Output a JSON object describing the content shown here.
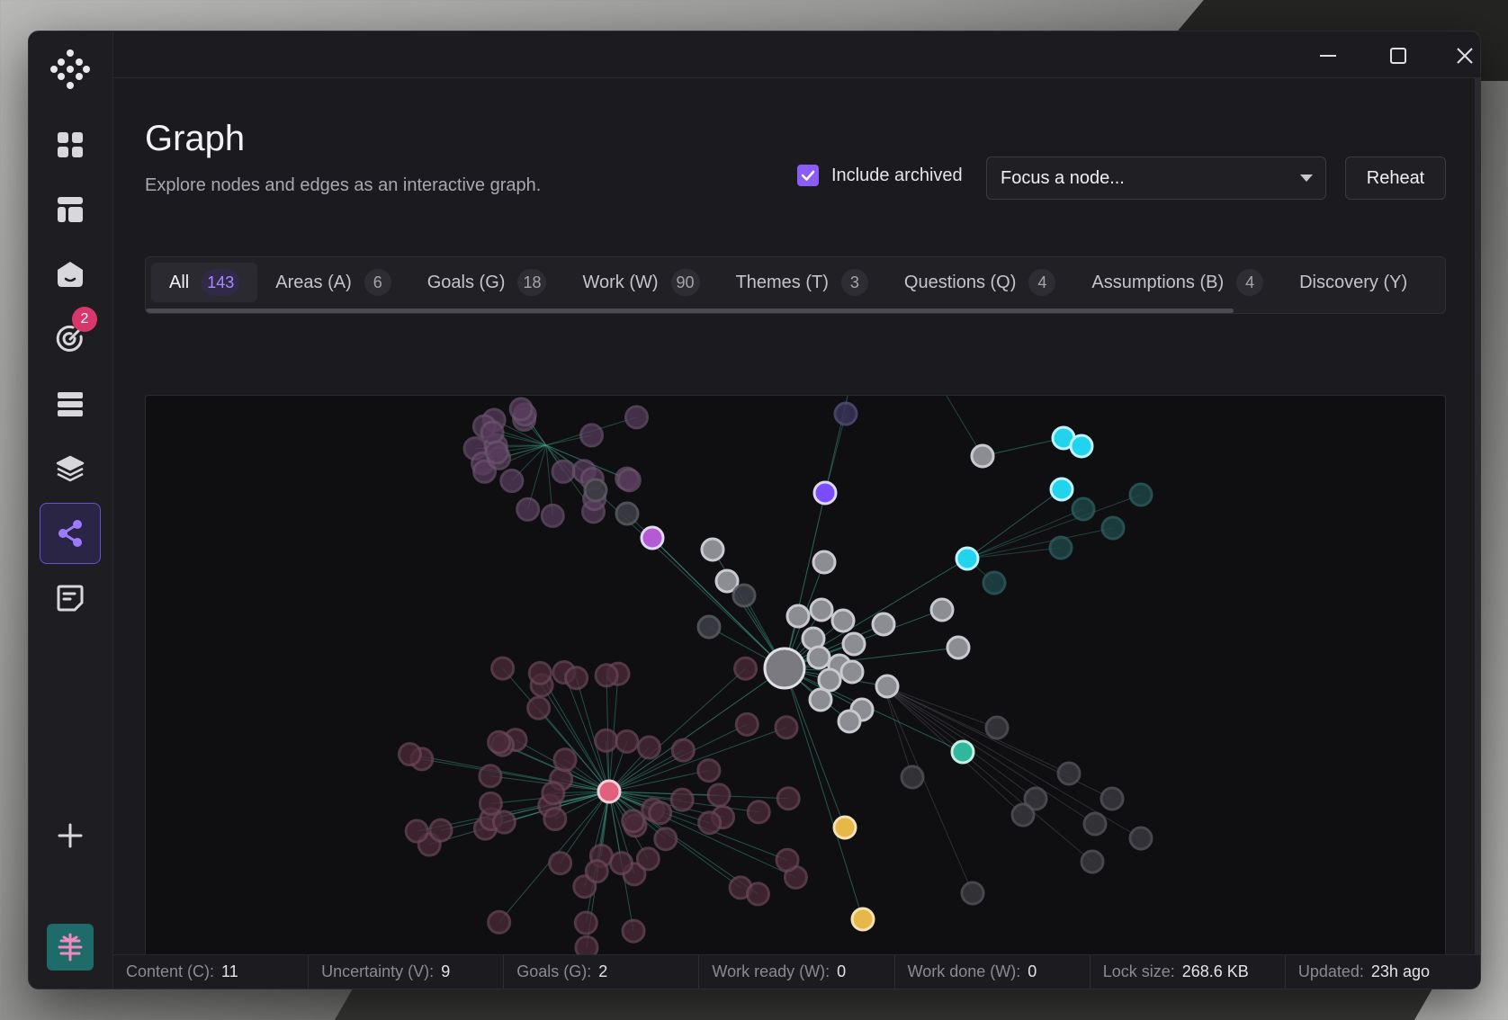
{
  "page": {
    "title": "Graph",
    "subtitle": "Explore nodes and edges as an interactive graph."
  },
  "controls": {
    "include_archived_label": "Include archived",
    "include_archived_checked": true,
    "focus_placeholder": "Focus a node...",
    "reheat_label": "Reheat"
  },
  "sidebar": {
    "items": [
      {
        "name": "dashboard",
        "icon": "grid-icon"
      },
      {
        "name": "layout",
        "icon": "layout-icon"
      },
      {
        "name": "areas",
        "icon": "house-icon"
      },
      {
        "name": "goals",
        "icon": "target-icon",
        "badge": "2"
      },
      {
        "name": "list",
        "icon": "list-icon"
      },
      {
        "name": "layers",
        "icon": "layers-icon"
      },
      {
        "name": "graph",
        "icon": "share-icon",
        "active": true
      },
      {
        "name": "notes",
        "icon": "note-icon"
      }
    ],
    "add_icon": "plus-icon",
    "avatar_icon": "tree-icon"
  },
  "tabs": [
    {
      "label": "All",
      "count": "143",
      "active": true
    },
    {
      "label": "Areas (A)",
      "count": "6"
    },
    {
      "label": "Goals (G)",
      "count": "18"
    },
    {
      "label": "Work (W)",
      "count": "90"
    },
    {
      "label": "Themes (T)",
      "count": "3"
    },
    {
      "label": "Questions (Q)",
      "count": "4"
    },
    {
      "label": "Assumptions (B)",
      "count": "4"
    },
    {
      "label": "Discovery (Y)",
      "count": ""
    }
  ],
  "status": [
    {
      "label": "Content (C):",
      "value": "11"
    },
    {
      "label": "Uncertainty (V):",
      "value": "9"
    },
    {
      "label": "Goals (G):",
      "value": "2"
    },
    {
      "label": "Work ready (W):",
      "value": "0"
    },
    {
      "label": "Work done (W):",
      "value": "0"
    },
    {
      "label": "Lock size:",
      "value": "268.6 KB"
    },
    {
      "label": "Updated:",
      "value": "23h ago"
    }
  ],
  "colors": {
    "accent": "#8b5cf6",
    "badge": "#d9376b",
    "node_gray": "#c9c9d0",
    "node_cyan": "#22d3ee",
    "node_purple": "#7c4dff",
    "node_pink": "#e0607e",
    "node_yellow": "#e6b84a",
    "node_teal": "#2fb99a",
    "edge": "#3f9f87"
  }
}
